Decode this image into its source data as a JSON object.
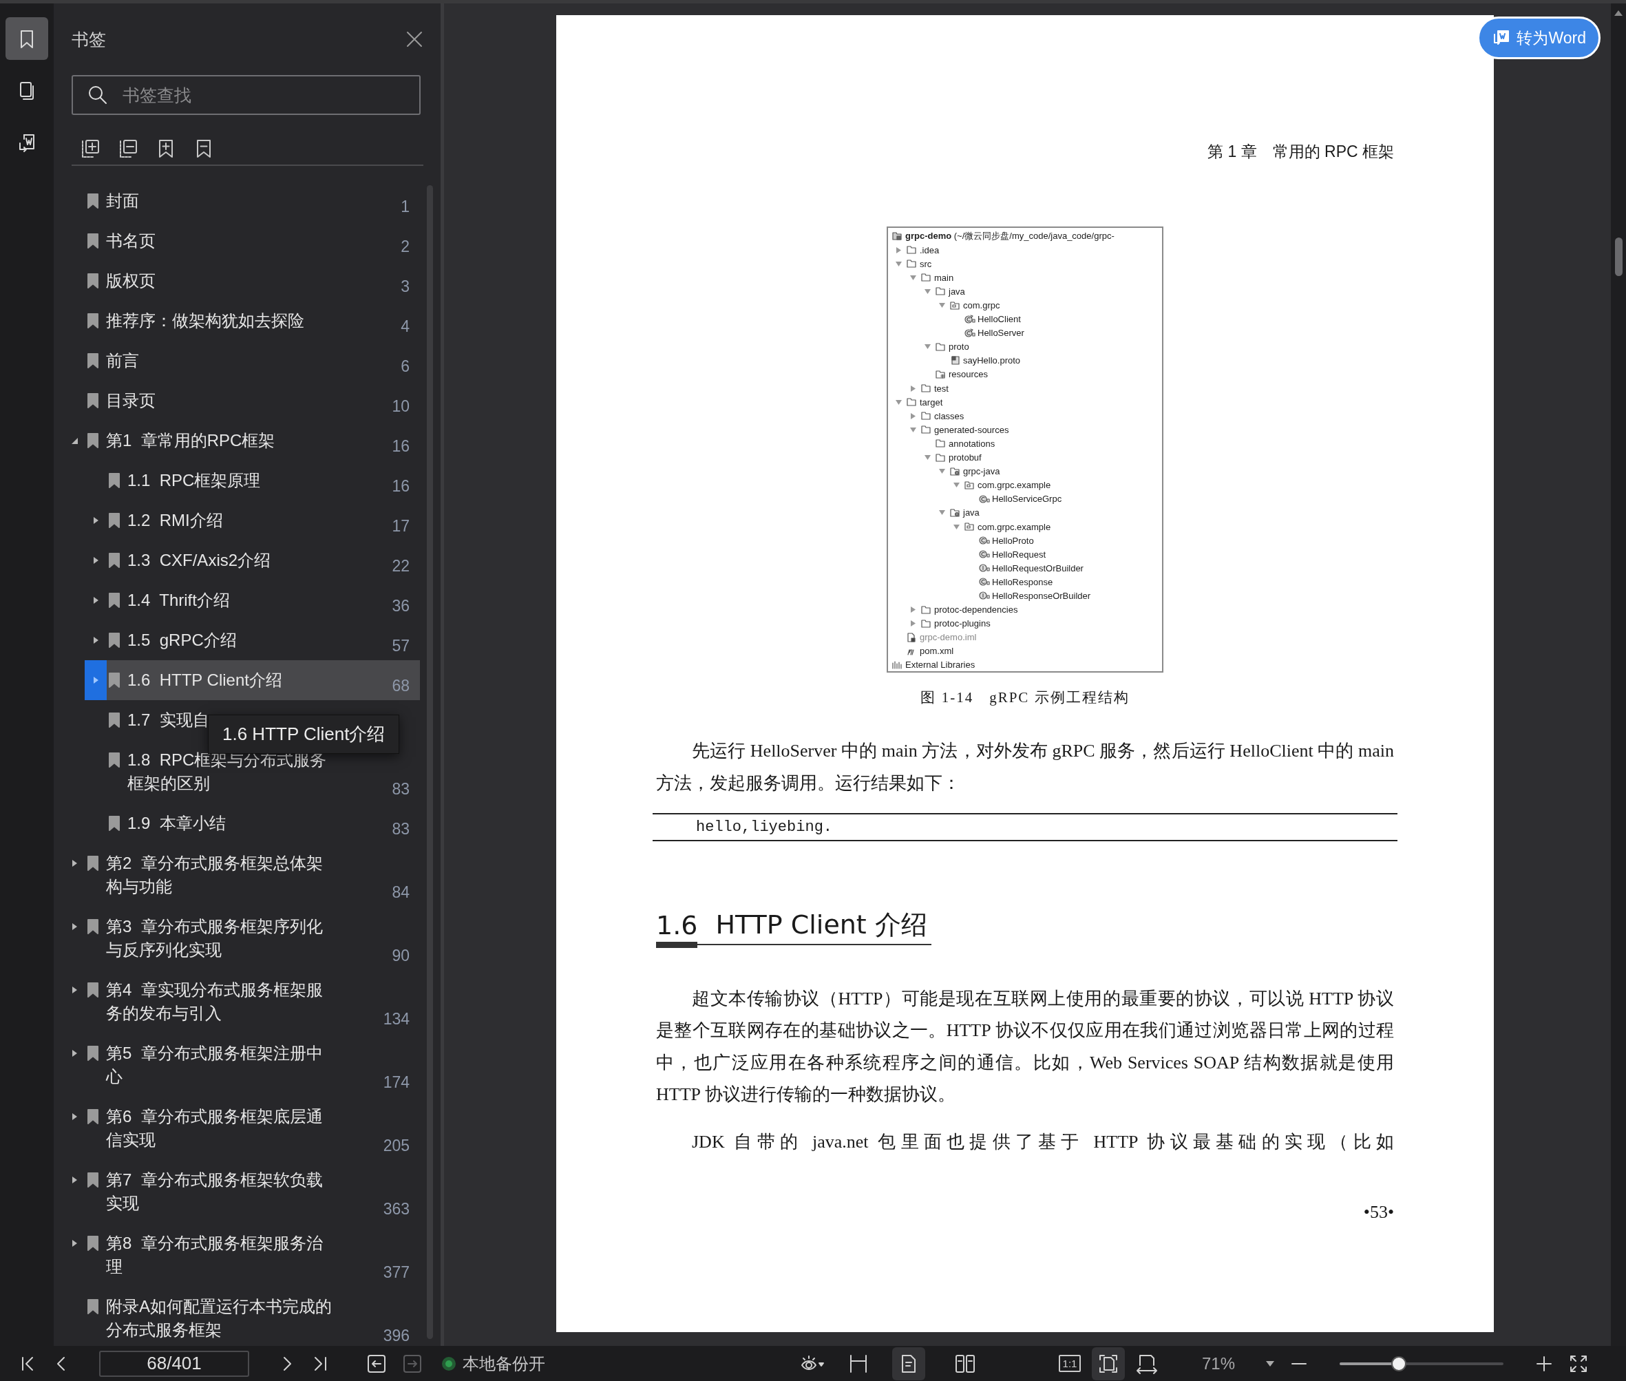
{
  "rail": [
    {
      "kind": "bookmarks",
      "selected": true
    },
    {
      "kind": "thumbnails",
      "selected": false
    },
    {
      "kind": "convert",
      "selected": false
    }
  ],
  "sidebar": {
    "title": "书签",
    "search": {
      "placeholder": "书签查找"
    },
    "bookmarks": [
      {
        "title": "封面",
        "page": "1",
        "selected": false
      },
      {
        "title": "书名页",
        "page": "2",
        "selected": false
      },
      {
        "title": "版权页",
        "page": "3",
        "selected": false
      },
      {
        "title": "推荐序：做架构犹如去探险",
        "page": "4",
        "selected": false
      },
      {
        "title": "前言",
        "page": "6",
        "selected": false
      },
      {
        "title": "目录页",
        "page": "10",
        "selected": false
      },
      {
        "title": "第1  章常用的RPC框架",
        "page": "16",
        "selected": false,
        "expanded": true,
        "children": [
          {
            "title": "1.1  RPC框架原理",
            "page": "16",
            "selected": false
          },
          {
            "title": "1.2  RMI介绍",
            "page": "17",
            "selected": false,
            "expanded": false
          },
          {
            "title": "1.3  CXF/Axis2介绍",
            "page": "22",
            "selected": false,
            "expanded": false
          },
          {
            "title": "1.4  Thrift介绍",
            "page": "36",
            "selected": false,
            "expanded": false
          },
          {
            "title": "1.5  gRPC介绍",
            "page": "57",
            "selected": false,
            "expanded": false
          },
          {
            "title": "1.6  HTTP Client介绍",
            "page": "68",
            "selected": true,
            "expanded": false
          },
          {
            "title": "1.7  实现自",
            "selected": false
          },
          {
            "title": "1.8  RPC框架与分布式服务框架的区别",
            "page": "83",
            "selected": false
          },
          {
            "title": "1.9  本章小结",
            "page": "83",
            "selected": false
          }
        ]
      },
      {
        "title": "第2  章分布式服务框架总体架构与功能",
        "page": "84",
        "selected": false,
        "expanded": false
      },
      {
        "title": "第3  章分布式服务框架序列化与反序列化实现",
        "page": "90",
        "selected": false,
        "expanded": false
      },
      {
        "title": "第4  章实现分布式服务框架服务的发布与引入",
        "page": "134",
        "selected": false,
        "expanded": false
      },
      {
        "title": "第5  章分布式服务框架注册中心",
        "page": "174",
        "selected": false,
        "expanded": false
      },
      {
        "title": "第6  章分布式服务框架底层通信实现",
        "page": "205",
        "selected": false,
        "expanded": false
      },
      {
        "title": "第7  章分布式服务框架软负载实现",
        "page": "363",
        "selected": false,
        "expanded": false
      },
      {
        "title": "第8  章分布式服务框架服务治理",
        "page": "377",
        "selected": false,
        "expanded": false
      },
      {
        "title": "附录A如何配置运行本书完成的分布式服务框架",
        "page": "396",
        "selected": false
      }
    ],
    "tooltip": "1.6 HTTP Client介绍"
  },
  "document": {
    "convert_button": "转为Word",
    "page": {
      "header": "第 1 章　常用的 RPC 框架",
      "blocks": [
        {
          "kind": "figure",
          "caption": "图 1-14　gRPC 示例工程结构",
          "tree": [
            {
              "label": "**grpc-demo** (~/微云同步盘/my_code/java_code/grpc-",
              "kind": "module",
              "children": [
                {
                  "label": ".idea",
                  "kind": "folder",
                  "expanded": false
                },
                {
                  "label": "src",
                  "kind": "folder",
                  "expanded": true,
                  "children": [
                    {
                      "label": "main",
                      "kind": "folder",
                      "expanded": true,
                      "children": [
                        {
                          "label": "java",
                          "kind": "folder",
                          "expanded": true,
                          "children": [
                            {
                              "label": "com.grpc",
                              "kind": "package",
                              "expanded": true,
                              "children": [
                                {
                                  "label": "HelloClient",
                                  "kind": "run-class"
                                },
                                {
                                  "label": "HelloServer",
                                  "kind": "run-class"
                                }
                              ]
                            }
                          ]
                        },
                        {
                          "label": "proto",
                          "kind": "folder",
                          "expanded": true,
                          "children": [
                            {
                              "label": "sayHello.proto",
                              "kind": "proto-file"
                            }
                          ]
                        },
                        {
                          "label": "resources",
                          "kind": "resources-folder"
                        }
                      ]
                    },
                    {
                      "label": "test",
                      "kind": "folder",
                      "expanded": false
                    }
                  ]
                },
                {
                  "label": "target",
                  "kind": "folder",
                  "expanded": true,
                  "children": [
                    {
                      "label": "classes",
                      "kind": "folder",
                      "expanded": false
                    },
                    {
                      "label": "generated-sources",
                      "kind": "folder",
                      "expanded": true,
                      "children": [
                        {
                          "label": "annotations",
                          "kind": "folder"
                        },
                        {
                          "label": "protobuf",
                          "kind": "folder",
                          "expanded": true,
                          "children": [
                            {
                              "label": "grpc-java",
                              "kind": "generated-folder",
                              "expanded": true,
                              "children": [
                                {
                                  "label": "com.grpc.example",
                                  "kind": "package",
                                  "expanded": true,
                                  "children": [
                                    {
                                      "label": "HelloServiceGrpc",
                                      "kind": "class"
                                    }
                                  ]
                                }
                              ]
                            },
                            {
                              "label": "java",
                              "kind": "generated-folder",
                              "expanded": true,
                              "children": [
                                {
                                  "label": "com.grpc.example",
                                  "kind": "package",
                                  "expanded": true,
                                  "children": [
                                    {
                                      "label": "HelloProto",
                                      "kind": "class"
                                    },
                                    {
                                      "label": "HelloRequest",
                                      "kind": "class"
                                    },
                                    {
                                      "label": "HelloRequestOrBuilder",
                                      "kind": "interface"
                                    },
                                    {
                                      "label": "HelloResponse",
                                      "kind": "class"
                                    },
                                    {
                                      "label": "HelloResponseOrBuilder",
                                      "kind": "interface"
                                    }
                                  ]
                                }
                              ]
                            }
                          ]
                        }
                      ]
                    },
                    {
                      "label": "protoc-dependencies",
                      "kind": "folder",
                      "expanded": false
                    },
                    {
                      "label": "protoc-plugins",
                      "kind": "folder",
                      "expanded": false
                    }
                  ]
                },
                {
                  "label": "grpc-demo.iml",
                  "kind": "iml-file"
                },
                {
                  "label": "pom.xml",
                  "kind": "maven-file"
                }
              ]
            },
            {
              "label": "External Libraries",
              "kind": "libraries"
            }
          ]
        },
        {
          "kind": "paragraph",
          "text": "先运行 HelloServer 中的 main 方法，对外发布 gRPC 服务，然后运行 HelloClient 中的 main 方法，发起服务调用。运行结果如下："
        },
        {
          "kind": "code",
          "text": "hello,liyebing."
        },
        {
          "kind": "heading",
          "number": "1.6",
          "title": "HTTP Client 介绍"
        },
        {
          "kind": "paragraph",
          "text": "超文本传输协议（HTTP）可能是现在互联网上使用的最重要的协议，可以说 HTTP 协议是整个互联网存在的基础协议之一。HTTP 协议不仅仅应用在我们通过浏览器日常上网的过程中，也广泛应用在各种系统程序之间的通信。比如，Web Services SOAP 结构数据就是使用 HTTP 协议进行传输的一种数据协议。"
        },
        {
          "kind": "paragraph",
          "text": "JDK 自带的 java.net 包里面也提供了基于 HTTP 协议最基础的实现（比如"
        }
      ],
      "page_number": "•53•"
    }
  },
  "status_bar": {
    "page_field": "68/401",
    "history": [
      {
        "kind": "back",
        "disabled": false
      },
      {
        "kind": "forward",
        "disabled": true
      }
    ],
    "backup": {
      "label": "本地备份开",
      "on": true
    },
    "page_modes": [
      {
        "kind": "single",
        "selected": true
      },
      {
        "kind": "double",
        "selected": false
      }
    ],
    "zoom_modes": [
      {
        "kind": "actual",
        "label": "1:1",
        "selected": false
      },
      {
        "kind": "fit-page",
        "selected": true
      },
      {
        "kind": "fit-width",
        "selected": false
      }
    ],
    "zoom": "71%",
    "zoom_slider": {
      "level": 0.36
    }
  }
}
